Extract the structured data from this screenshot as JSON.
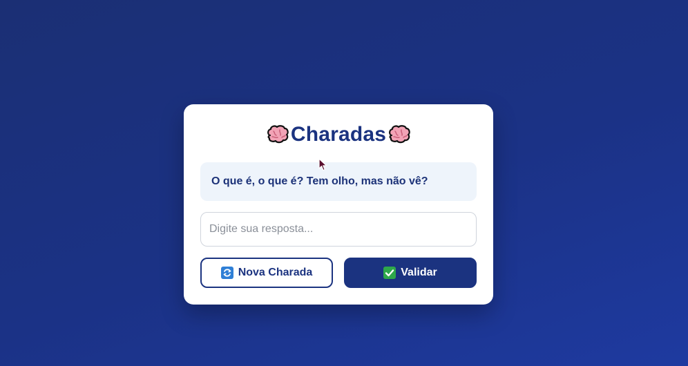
{
  "app": {
    "title": "Charadas"
  },
  "riddle": {
    "question": "O que é, o que é? Tem olho, mas não vê?"
  },
  "answer": {
    "value": "",
    "placeholder": "Digite sua resposta..."
  },
  "buttons": {
    "new_label": "Nova Charada",
    "new_icon": "refresh-icon",
    "validate_label": "Validar",
    "validate_icon": "check-icon"
  },
  "colors": {
    "primary": "#1b3380",
    "riddle_background": "#eef4fb",
    "page_background": "#1b3286"
  }
}
